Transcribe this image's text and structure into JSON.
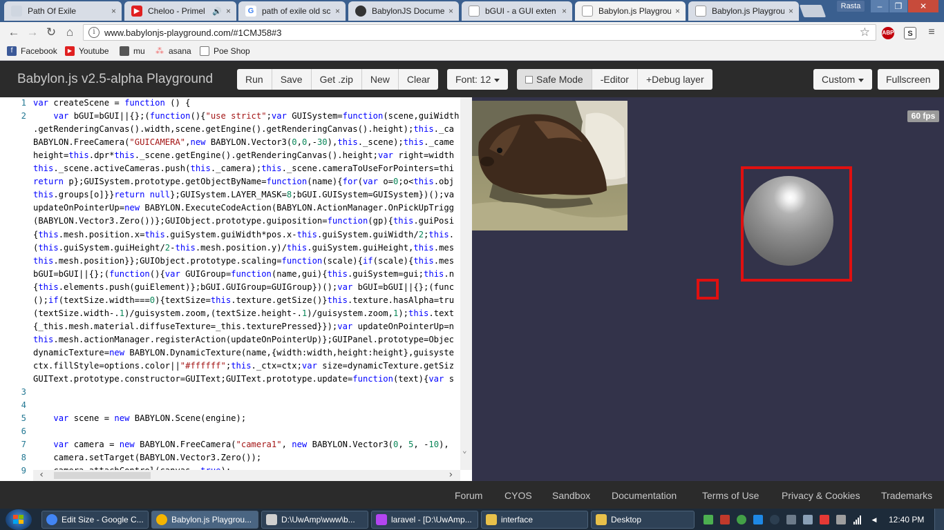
{
  "browser": {
    "tabs": [
      {
        "title": "Path Of Exile",
        "icon": "document-icon",
        "color": "#cfd6e0"
      },
      {
        "title": "Cheloo - Primel",
        "icon": "youtube-icon",
        "color": "#e02020"
      },
      {
        "title": "path of exile old sc",
        "icon": "google-icon",
        "color": "#4285f4"
      },
      {
        "title": "BabylonJS Docume",
        "icon": "github-icon",
        "color": "#333333"
      },
      {
        "title": "bGUI - a GUI exten",
        "icon": "document-icon",
        "color": "#cfd6e0"
      },
      {
        "title": "Babylon.js Playgrou",
        "icon": "document-icon",
        "color": "#cfd6e0"
      },
      {
        "title": "Babylon.js Playgrou",
        "icon": "document-icon",
        "color": "#cfd6e0"
      }
    ],
    "tab_close": "×",
    "audio_icon": "🔊",
    "user": "Rasta",
    "window_controls": {
      "minimize": "–",
      "maximize": "❐",
      "close": "✕"
    },
    "url": "www.babylonjs-playground.com/#1CMJ58#3",
    "bookmarks": [
      {
        "label": "Facebook",
        "icon": "facebook-icon",
        "color": "#3b5998"
      },
      {
        "label": "Youtube",
        "icon": "youtube-icon",
        "color": "#e02020"
      },
      {
        "label": "mu",
        "icon": "folder-icon",
        "color": "#555555"
      },
      {
        "label": "asana",
        "icon": "asana-icon",
        "color": "#f06a6a"
      },
      {
        "label": "Poe Shop",
        "icon": "document-icon",
        "color": "#ffffff"
      }
    ],
    "extensions": [
      {
        "label": "ABP",
        "icon": "adblock-icon",
        "color": "#c2000b"
      },
      {
        "label": "S",
        "icon": "extension-icon",
        "color": "#555555"
      }
    ]
  },
  "playground": {
    "title": "Babylon.js v2.5-alpha Playground",
    "actions": [
      "Run",
      "Save",
      "Get .zip",
      "New",
      "Clear"
    ],
    "font_label": "Font: 12",
    "safe_mode_label": "Safe Mode",
    "editor_toggle": "-Editor",
    "debug_toggle": "+Debug layer",
    "custom_label": "Custom",
    "fullscreen_label": "Fullscreen",
    "fps": "60 fps",
    "footer_links": [
      "Forum",
      "CYOS",
      "Sandbox",
      "Documentation",
      "Terms of Use",
      "Privacy & Cookies",
      "Trademarks"
    ]
  },
  "editor": {
    "line_numbers": [
      "1",
      "2",
      "3",
      "4",
      "5",
      "6",
      "7",
      "8",
      "9"
    ],
    "lines": [
      "var createScene = function () {",
      "    var bGUI=bGUI||{};(function(){\"use strict\";var GUISystem=function(scene,guiWidth",
      ".getRenderingCanvas().width,scene.getEngine().getRenderingCanvas().height);this._ca",
      "BABYLON.FreeCamera(\"GUICAMERA\",new BABYLON.Vector3(0,0,-30),this._scene);this._came",
      "height=this.dpr*this._scene.getEngine().getRenderingCanvas().height;var right=width",
      "this._scene.activeCameras.push(this._camera);this._scene.cameraToUseForPointers=thi",
      "return p};GUISystem.prototype.getObjectByName=function(name){for(var o=0;o<this.obj",
      "this.groups[o]}}return null};GUISystem.LAYER_MASK=8;bGUI.GUISystem=GUISystem})();va",
      "updateOnPointerUp=new BABYLON.ExecuteCodeAction(BABYLON.ActionManager.OnPickUpTrigg",
      "(BABYLON.Vector3.Zero())};GUIObject.prototype.guiposition=function(gp){this.guiPosi",
      "{this.mesh.position.x=this.guiSystem.guiWidth*pos.x-this.guiSystem.guiWidth/2;this.",
      "(this.guiSystem.guiHeight/2-this.mesh.position.y)/this.guiSystem.guiHeight,this.mes",
      "this.mesh.position}};GUIObject.prototype.scaling=function(scale){if(scale){this.mes",
      "bGUI=bGUI||{};(function(){var GUIGroup=function(name,gui){this.guiSystem=gui;this.n",
      "{this.elements.push(guiElement)};bGUI.GUIGroup=GUIGroup})();var bGUI=bGUI||{};(func",
      "();if(textSize.width===0){textSize=this.texture.getSize()}this.texture.hasAlpha=tru",
      "(textSize.width-.1)/guisystem.zoom,(textSize.height-.1)/guisystem.zoom,1);this.text",
      "{_this.mesh.material.diffuseTexture=_this.texturePressed}});var updateOnPointerUp=n",
      "this.mesh.actionManager.registerAction(updateOnPointerUp)};GUIPanel.prototype=Objec",
      "dynamicTexture=new BABYLON.DynamicTexture(name,{width:width,height:height},guisyste",
      "ctx.fillStyle=options.color||\"#ffffff\";this._ctx=ctx;var size=dynamicTexture.getSiz",
      "GUIText.prototype.constructor=GUIText;GUIText.prototype.update=function(text){var s",
      "",
      "",
      "    var scene = new BABYLON.Scene(engine);",
      "",
      "    var camera = new BABYLON.FreeCamera(\"camera1\", new BABYLON.Vector3(0, 5, -10),",
      "    camera.setTarget(BABYLON.Vector3.Zero());",
      "    camera.attachControl(canvas, true);"
    ]
  },
  "taskbar": {
    "tasks": [
      {
        "label": "Edit Size - Google C...",
        "icon": "chrome-icon",
        "color": "#4285f4"
      },
      {
        "label": "Babylon.js Playgrou...",
        "icon": "chrome-icon",
        "color": "#f4b400"
      },
      {
        "label": "D:\\UwAmp\\www\\b...",
        "icon": "notepad-icon",
        "color": "#cfcfcf"
      },
      {
        "label": "laravel - [D:\\UwAmp...",
        "icon": "phpstorm-icon",
        "color": "#b345f1"
      },
      {
        "label": "interface",
        "icon": "folder-icon",
        "color": "#e8c04a"
      },
      {
        "label": "Desktop",
        "icon": "folder-icon",
        "color": "#e8c04a"
      }
    ],
    "time": "12:40 PM"
  }
}
